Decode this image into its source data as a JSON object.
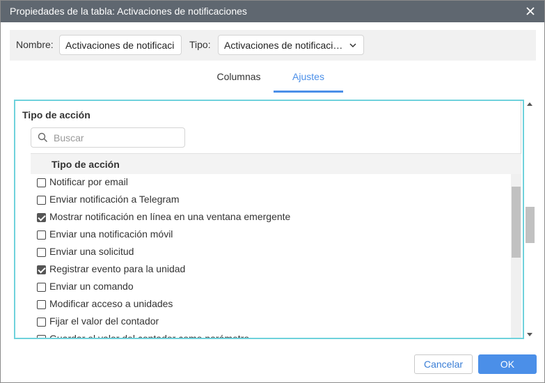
{
  "window": {
    "title": "Propiedades de la tabla: Activaciones de notificaciones",
    "close_icon": "close-icon"
  },
  "top": {
    "name_label": "Nombre:",
    "name_value": "Activaciones de notificaci",
    "type_label": "Tipo:",
    "type_value": "Activaciones de notificaci…"
  },
  "tabs": [
    {
      "label": "Columnas",
      "active": false
    },
    {
      "label": "Ajustes",
      "active": true
    }
  ],
  "settings": {
    "section_title": "Tipo de acción",
    "search_placeholder": "Buscar",
    "list_header": "Tipo de acción",
    "items": [
      {
        "label": "Notificar por email",
        "checked": false
      },
      {
        "label": "Enviar notificación a Telegram",
        "checked": false
      },
      {
        "label": "Mostrar notificación en línea en una ventana emergente",
        "checked": true
      },
      {
        "label": "Enviar una notificación móvil",
        "checked": false
      },
      {
        "label": "Enviar una solicitud",
        "checked": false
      },
      {
        "label": "Registrar evento para la unidad",
        "checked": true
      },
      {
        "label": "Enviar un comando",
        "checked": false
      },
      {
        "label": "Modificar acceso a unidades",
        "checked": false
      },
      {
        "label": "Fijar el valor del contador",
        "checked": false
      },
      {
        "label": "Guardar el valor del contador como parámetro",
        "checked": false
      }
    ]
  },
  "buttons": {
    "cancel": "Cancelar",
    "ok": "OK"
  },
  "colors": {
    "titlebar": "#5f6770",
    "accent": "#4b8fe8",
    "panel_border": "#6fd2dc"
  }
}
